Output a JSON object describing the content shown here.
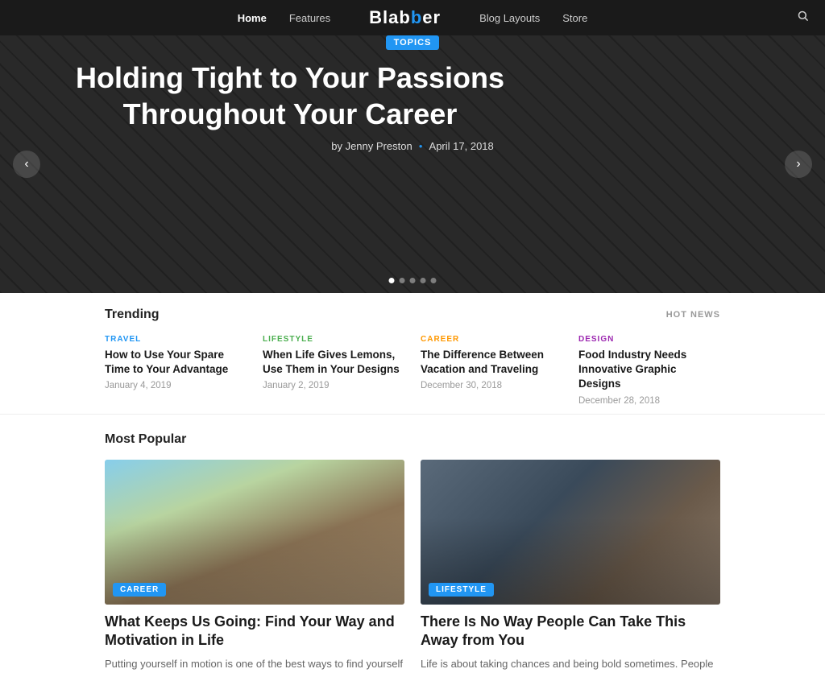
{
  "nav": {
    "links": [
      {
        "label": "Home",
        "active": true
      },
      {
        "label": "Features",
        "active": false
      },
      {
        "label": "Blog Layouts",
        "active": false
      },
      {
        "label": "Store",
        "active": false
      }
    ],
    "logo": "Blab",
    "logo_accent": "b",
    "logo_rest": "er",
    "search_icon": "🔍"
  },
  "hero": {
    "badge": "TOPICS",
    "title": "Holding Tight to Your Passions Throughout Your Career",
    "author": "by Jenny Preston",
    "date": "April 17, 2018",
    "dots": [
      true,
      false,
      false,
      false,
      false
    ]
  },
  "trending": {
    "section_title": "Trending",
    "hot_news_label": "HOT NEWS",
    "items": [
      {
        "category": "TRAVEL",
        "category_class": "cat-travel",
        "title": "How to Use Your Spare Time to Your Advantage",
        "date": "January 4, 2019"
      },
      {
        "category": "LIFESTYLE",
        "category_class": "cat-lifestyle",
        "title": "When Life Gives Lemons, Use Them in Your Designs",
        "date": "January 2, 2019"
      },
      {
        "category": "CAREER",
        "category_class": "cat-career",
        "title": "The Difference Between Vacation and Traveling",
        "date": "December 30, 2018"
      },
      {
        "category": "DESIGN",
        "category_class": "cat-design",
        "title": "Food Industry Needs Innovative Graphic Designs",
        "date": "December 28, 2018"
      }
    ]
  },
  "most_popular": {
    "section_title": "Most Popular",
    "cards": [
      {
        "badge": "CAREER",
        "badge_class": "badge-career",
        "img_class": "img-running",
        "title": "What Keeps Us Going: Find Your Way and Motivation in Life",
        "desc": "Putting yourself in motion is one of the best ways to find yourself"
      },
      {
        "badge": "LIFESTYLE",
        "badge_class": "badge-lifestyle",
        "img_class": "img-workshop",
        "title": "There Is No Way People Can Take This Away from You",
        "desc": "Life is about taking chances and being bold sometimes. People"
      }
    ]
  }
}
